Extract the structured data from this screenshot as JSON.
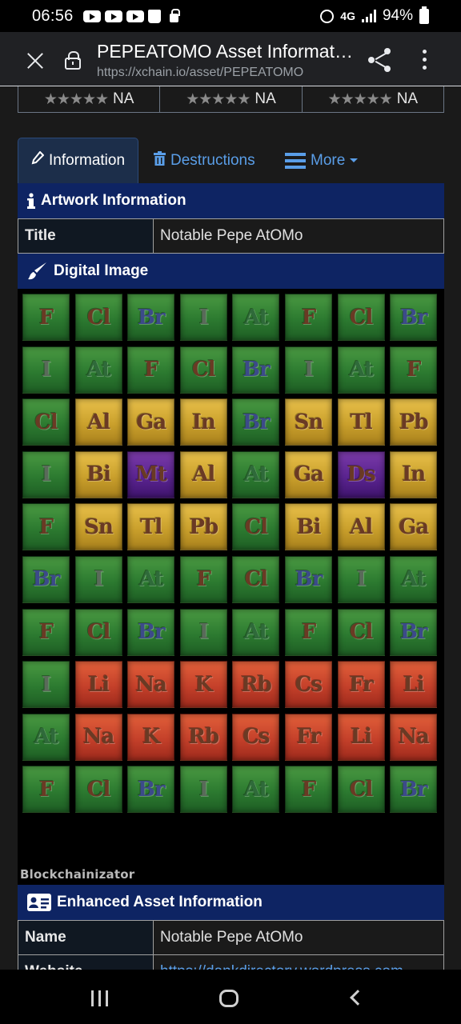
{
  "status_bar": {
    "time": "06:56",
    "network": "4G",
    "battery": "94%"
  },
  "browser": {
    "title": "PEPEATOMO Asset Informat…",
    "url": "https://xchain.io/asset/PEPEATOMO"
  },
  "ratings": [
    {
      "stars": "★★★★★",
      "value": "NA"
    },
    {
      "stars": "★★★★★",
      "value": "NA"
    },
    {
      "stars": "★★★★★",
      "value": "NA"
    }
  ],
  "tabs": [
    {
      "label": "Information",
      "icon": "pencil-icon"
    },
    {
      "label": "Destructions",
      "icon": "trash-icon"
    },
    {
      "label": "More",
      "icon": "list-icon"
    }
  ],
  "artwork": {
    "header": "Artwork Information",
    "title_key": "Title",
    "title_value": "Notable Pepe AtOMo"
  },
  "digital_image": {
    "header": "Digital Image",
    "watermark": "Blockchainizator",
    "grid": [
      [
        "F",
        "Cl",
        "Br",
        "I",
        "At",
        "F",
        "Cl",
        "Br"
      ],
      [
        "I",
        "At",
        "F",
        "Cl",
        "Br",
        "I",
        "At",
        "F"
      ],
      [
        "Cl",
        "Al",
        "Ga",
        "In",
        "Br",
        "Sn",
        "Tl",
        "Pb"
      ],
      [
        "I",
        "Bi",
        "Mt",
        "Al",
        "At",
        "Ga",
        "Ds",
        "In"
      ],
      [
        "F",
        "Sn",
        "Tl",
        "Pb",
        "Cl",
        "Bi",
        "Al",
        "Ga"
      ],
      [
        "Br",
        "I",
        "At",
        "F",
        "Cl",
        "Br",
        "I",
        "At"
      ],
      [
        "F",
        "Cl",
        "Br",
        "I",
        "At",
        "F",
        "Cl",
        "Br"
      ],
      [
        "I",
        "Li",
        "Na",
        "K",
        "Rb",
        "Cs",
        "Fr",
        "Li"
      ],
      [
        "At",
        "Na",
        "K",
        "Rb",
        "Cs",
        "Fr",
        "Li",
        "Na"
      ],
      [
        "F",
        "Cl",
        "Br",
        "I",
        "At",
        "F",
        "Cl",
        "Br"
      ]
    ],
    "colors": {
      "halogen": "#2c7a30",
      "metal": "#caa02c",
      "alkali": "#c4402a",
      "transition": "#5a2490"
    }
  },
  "enhanced": {
    "header": "Enhanced Asset Information",
    "name_key": "Name",
    "name_value": "Notable Pepe AtOMo",
    "website_key": "Website",
    "website_value": "https://dankdirectory.wordpress.com"
  }
}
